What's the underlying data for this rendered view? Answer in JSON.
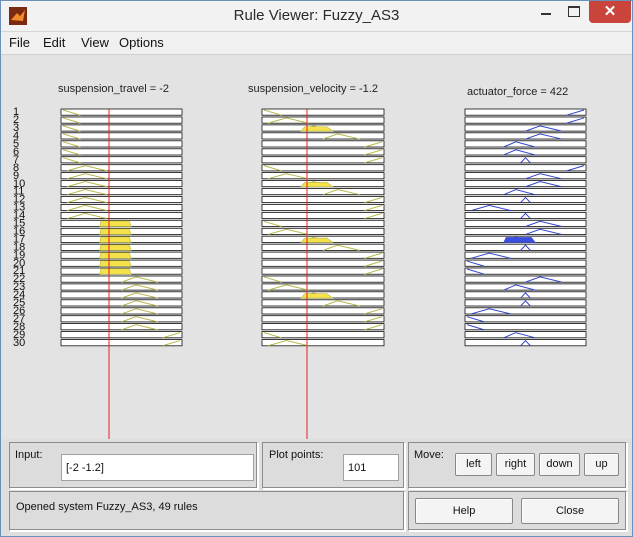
{
  "window": {
    "title": "Rule Viewer: Fuzzy_AS3",
    "close_glyph": "✕"
  },
  "menu": [
    "File",
    "Edit",
    "View",
    "Options"
  ],
  "columns": [
    {
      "title": "suspension_travel = -2"
    },
    {
      "title": "suspension_velocity = -1.2"
    },
    {
      "title": "actuator_force = 422"
    }
  ],
  "rules": {
    "visible_numbers": [
      "1",
      "2",
      "3",
      "4",
      "5",
      "6",
      "7",
      "8",
      "9",
      "10",
      "11",
      "12",
      "13",
      "14",
      "15",
      "16",
      "17",
      "18",
      "19",
      "20",
      "21",
      "22",
      "23",
      "24",
      "25",
      "26",
      "27",
      "28",
      "29",
      "30"
    ],
    "total": 49
  },
  "input": {
    "label": "Input:",
    "value": "[-2 -1.2]"
  },
  "plot_points": {
    "label": "Plot points:",
    "value": "101"
  },
  "move": {
    "label": "Move:",
    "buttons": [
      "left",
      "right",
      "down",
      "up"
    ]
  },
  "status": "Opened system Fuzzy_AS3, 49 rules",
  "buttons": {
    "help": "Help",
    "close": "Close"
  },
  "colors": {
    "input_fill": "#f5e24a",
    "output_fill": "#3a4ee0",
    "mf_line": "#b8b84a",
    "out_line": "#3344cc",
    "indicator": "#e02020"
  }
}
